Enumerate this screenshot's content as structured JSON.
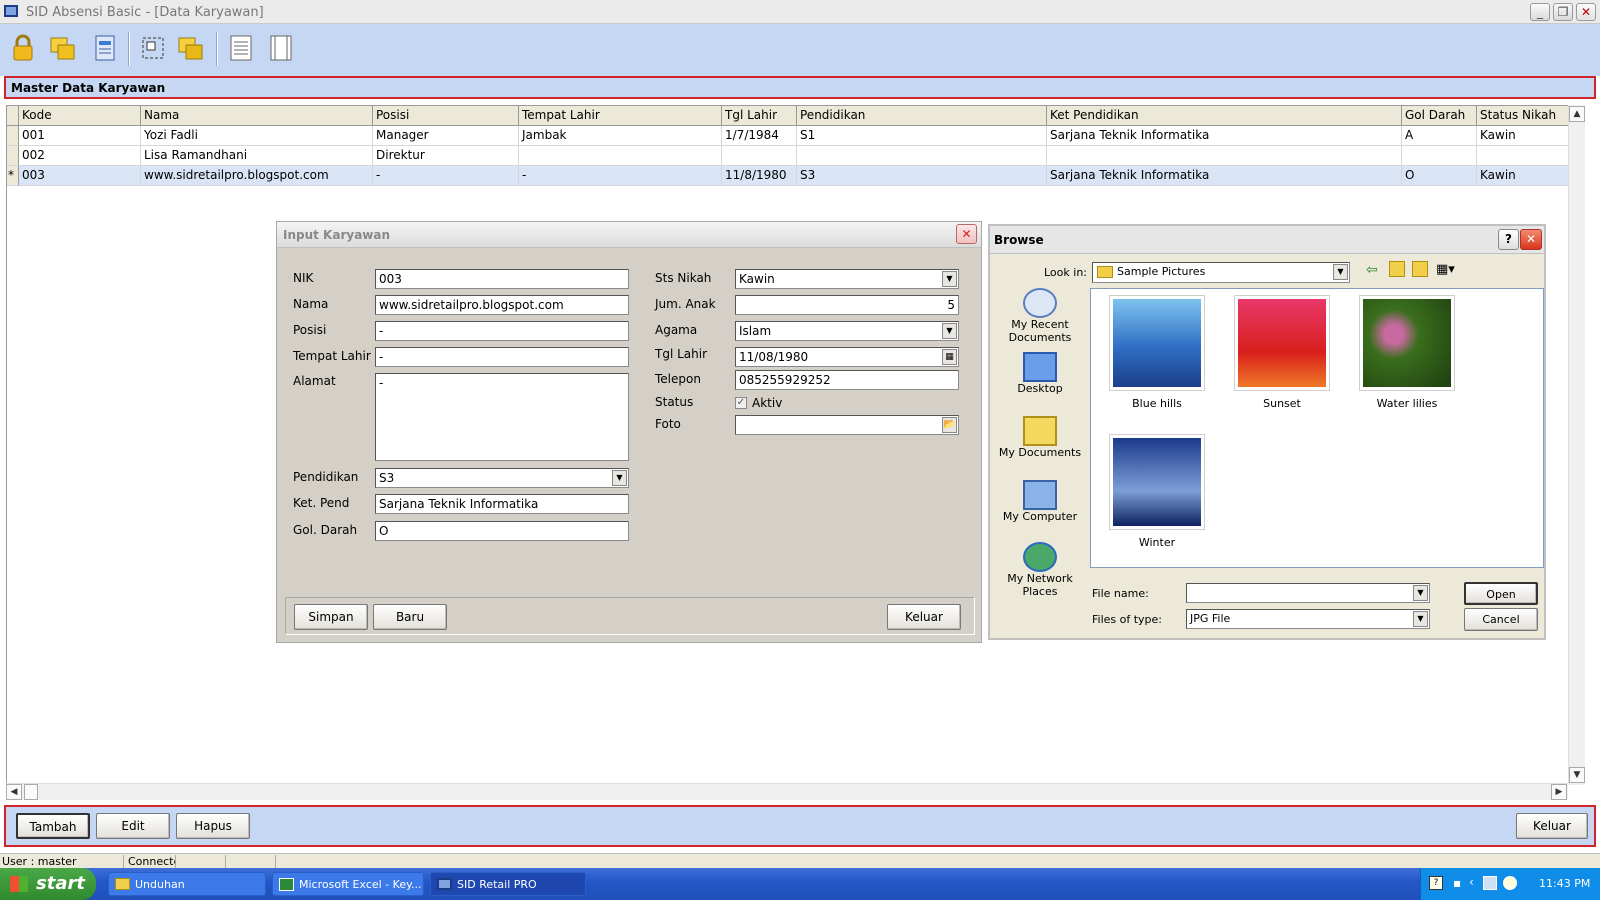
{
  "window": {
    "title": "SID Absensi Basic - [Data Karyawan]",
    "min": "_",
    "max": "❐",
    "close": "✕"
  },
  "toolbar": {
    "icons": [
      "lock-icon",
      "folders-icon",
      "report-icon",
      "select-icon",
      "copy-icon",
      "list-icon",
      "grid-icon"
    ]
  },
  "panel": {
    "title": "Master Data Karyawan"
  },
  "grid": {
    "columns": [
      "Kode",
      "Nama",
      "Posisi",
      "Tempat Lahir",
      "Tgl Lahir",
      "Pendidikan",
      "Ket Pendidikan",
      "Gol Darah",
      "Status Nikah"
    ],
    "rows": [
      {
        "marker": "",
        "cells": [
          "001",
          "Yozi Fadli",
          "Manager",
          "Jambak",
          "1/7/1984",
          "S1",
          "Sarjana Teknik Informatika",
          "A",
          "Kawin"
        ]
      },
      {
        "marker": "",
        "cells": [
          "002",
          "Lisa Ramandhani",
          "Direktur",
          "",
          "",
          "",
          "",
          "",
          ""
        ]
      },
      {
        "marker": "*",
        "cells": [
          "003",
          "www.sidretailpro.blogspot.com",
          "-",
          "-",
          "11/8/1980",
          "S3",
          "Sarjana Teknik Informatika",
          "O",
          "Kawin"
        ]
      }
    ]
  },
  "input_dialog": {
    "title": "Input Karyawan",
    "labels": {
      "nik": "NIK",
      "nama": "Nama",
      "posisi": "Posisi",
      "tempat": "Tempat Lahir",
      "alamat": "Alamat",
      "pendidikan": "Pendidikan",
      "ketpend": "Ket. Pend",
      "goldarah": "Gol. Darah",
      "stsnikah": "Sts Nikah",
      "jumanak": "Jum. Anak",
      "agama": "Agama",
      "tgllahir": "Tgl Lahir",
      "telepon": "Telepon",
      "status": "Status",
      "foto": "Foto"
    },
    "values": {
      "nik": "003",
      "nama": "www.sidretailpro.blogspot.com",
      "posisi": "-",
      "tempat": "-",
      "alamat": "-",
      "pendidikan": "S3",
      "ketpend": "Sarjana Teknik Informatika",
      "goldarah": "O",
      "stsnikah": "Kawin",
      "jumanak": "5",
      "agama": "Islam",
      "tgllahir": "11/08/1980",
      "telepon": "085255929252",
      "status_check": "Aktiv",
      "status_checked": true,
      "foto": ""
    },
    "buttons": {
      "simpan": "Simpan",
      "baru": "Baru",
      "keluar": "Keluar"
    }
  },
  "browse_dialog": {
    "title": "Browse",
    "help": "?",
    "lookin_label": "Look in:",
    "lookin_value": "Sample Pictures",
    "places": [
      "My Recent Documents",
      "Desktop",
      "My Documents",
      "My Computer",
      "My Network Places"
    ],
    "thumbnails": [
      {
        "name": "Blue hills",
        "colors": [
          "#7ec4ef",
          "#2f6ec4",
          "#1b3f8a"
        ]
      },
      {
        "name": "Sunset",
        "colors": [
          "#e8386a",
          "#d8201c",
          "#f07828"
        ]
      },
      {
        "name": "Water lilies",
        "colors": [
          "#3a6e1c",
          "#c86aa0",
          "#1e3e10"
        ]
      },
      {
        "name": "Winter",
        "colors": [
          "#1c3a8c",
          "#7d9ed6",
          "#0e2260"
        ]
      }
    ],
    "filename_label": "File name:",
    "filename_value": "",
    "filetype_label": "Files of type:",
    "filetype_value": "JPG File",
    "open": "Open",
    "cancel": "Cancel"
  },
  "bottom_bar": {
    "tambah": "Tambah",
    "edit": "Edit",
    "hapus": "Hapus",
    "keluar": "Keluar"
  },
  "statusbar": {
    "user": "User : master",
    "conn": "Connecte"
  },
  "taskbar": {
    "start": "start",
    "tasks": [
      "Unduhan",
      "Microsoft Excel - Key...",
      "SID Retail PRO"
    ],
    "clock": "11:43 PM"
  },
  "colors": {
    "accent_border": "#d2222a",
    "panel_bg": "#c5d7f2",
    "dialog_bg": "#d4d0c8"
  }
}
